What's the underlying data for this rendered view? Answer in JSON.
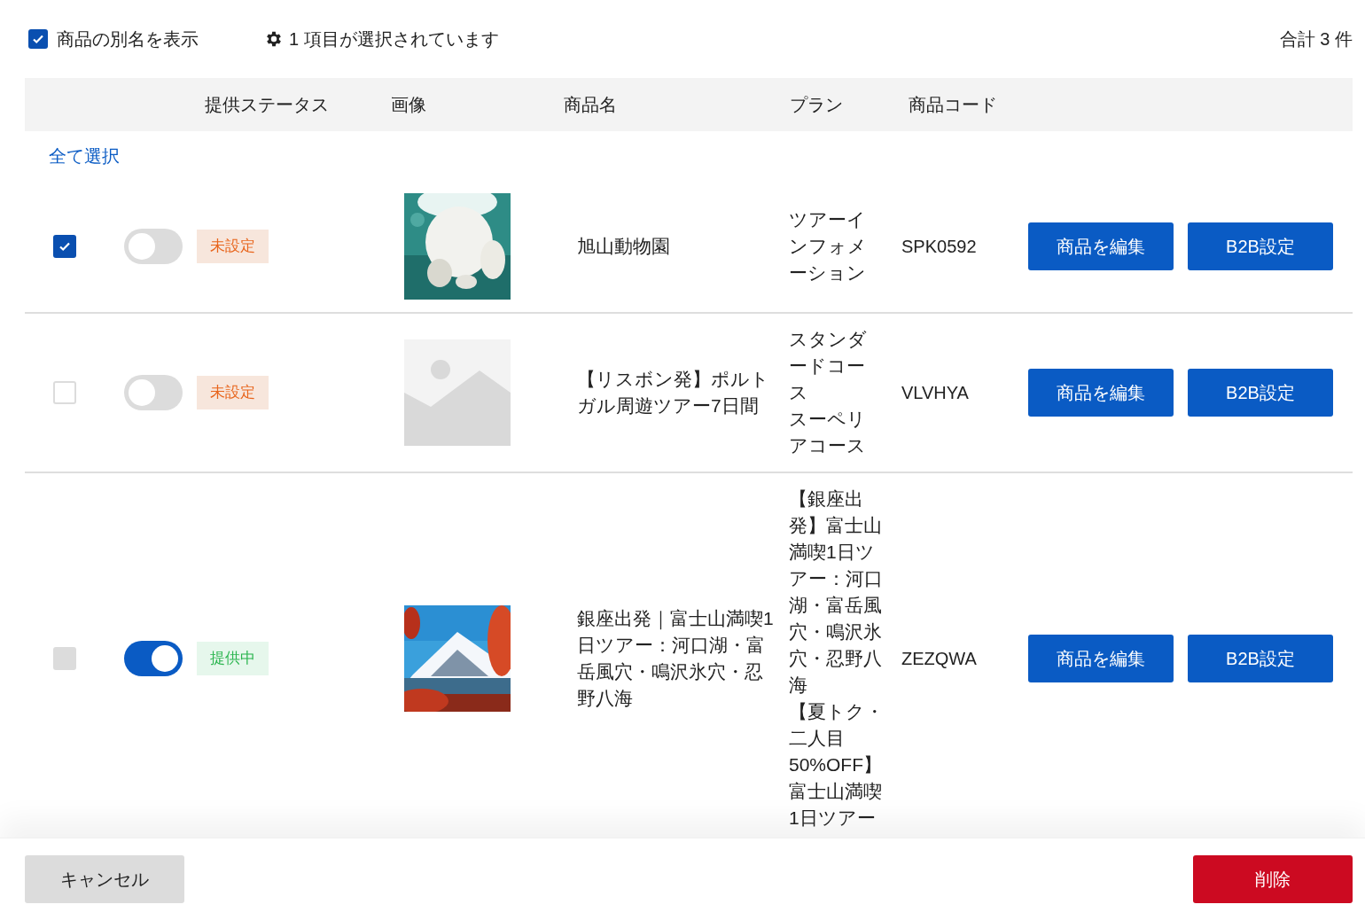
{
  "show_alias": {
    "label": "商品の別名を表示",
    "checked": true
  },
  "selection_info": "1 項目が選択されています",
  "total": "合計 3 件",
  "columns": [
    "提供ステータス",
    "画像",
    "商品名",
    "プラン",
    "商品コード"
  ],
  "select_all": "全て選択",
  "rows": [
    {
      "checked": true,
      "disabled": false,
      "on": false,
      "status": {
        "label": "未設定",
        "kind": "unset"
      },
      "image": {
        "kind": "picture"
      },
      "name": "旭山動物園",
      "plans": [
        "ツアーインフォメーション"
      ],
      "code": "SPK0592",
      "buttons": [
        "商品を編集",
        "B2B設定"
      ]
    },
    {
      "checked": false,
      "disabled": false,
      "on": false,
      "status": {
        "label": "未設定",
        "kind": "unset"
      },
      "image": {
        "kind": "placeholder"
      },
      "name": "【リスボン発】ポルトガル周遊ツアー7日間",
      "plans": [
        "スタンダードコース",
        "スーペリアコース"
      ],
      "code": "VLVHYA",
      "buttons": [
        "商品を編集",
        "B2B設定"
      ]
    },
    {
      "checked": false,
      "disabled": true,
      "on": true,
      "status": {
        "label": "提供中",
        "kind": "active"
      },
      "image": {
        "kind": "picture"
      },
      "name": "銀座出発｜富士山満喫1日ツアー：河口湖・富岳風穴・鳴沢氷穴・忍野八海",
      "plans": [
        "【銀座出発】富士山満喫1日ツアー：河口湖・富岳風穴・鳴沢氷穴・忍野八海",
        "【夏トク・二人目50%OFF】富士山満喫1日ツアー"
      ],
      "code": "ZEZQWA",
      "buttons": [
        "商品を編集",
        "B2B設定"
      ]
    }
  ],
  "footer": {
    "cancel": "キャンセル",
    "delete": "削除"
  }
}
